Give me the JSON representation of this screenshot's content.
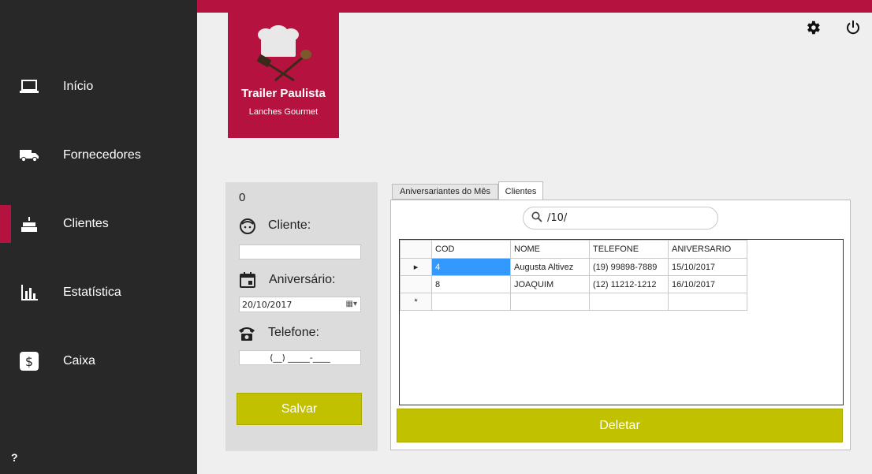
{
  "sidebar": {
    "items": [
      {
        "label": "Início",
        "icon": "laptop-icon"
      },
      {
        "label": "Fornecedores",
        "icon": "truck-icon"
      },
      {
        "label": "Clientes",
        "icon": "cake-icon"
      },
      {
        "label": "Estatística",
        "icon": "bar-chart-icon"
      },
      {
        "label": "Caixa",
        "icon": "dollar-icon"
      }
    ],
    "active": "Clientes",
    "help_label": "?"
  },
  "colors": {
    "accent": "#b5123f",
    "button": "#c1c100",
    "sidebar": "#282828"
  },
  "logo": {
    "brand": "Trailer Paulista",
    "tagline": "Lanches Gourmet"
  },
  "form": {
    "id_value": "0",
    "cliente_label": "Cliente:",
    "cliente_value": "",
    "aniversario_label": "Aniversário:",
    "aniversario_value": "20/10/2017",
    "telefone_label": "Telefone:",
    "telefone_value": "(__) _____-____",
    "save_label": "Salvar"
  },
  "tabs": [
    {
      "label": "Aniversariantes do Mês",
      "active": false
    },
    {
      "label": "Clientes",
      "active": true
    }
  ],
  "search": {
    "value": "/10/"
  },
  "grid": {
    "columns": [
      "COD",
      "NOME",
      "TELEFONE",
      "ANIVERSARIO"
    ],
    "rows": [
      [
        "4",
        "Augusta Altivez",
        "(19) 99898-7889",
        "15/10/2017"
      ],
      [
        "8",
        "JOAQUIM",
        "(12) 11212-1212",
        "16/10/2017"
      ]
    ],
    "new_row_marker": "*"
  },
  "delete_label": "Deletar"
}
